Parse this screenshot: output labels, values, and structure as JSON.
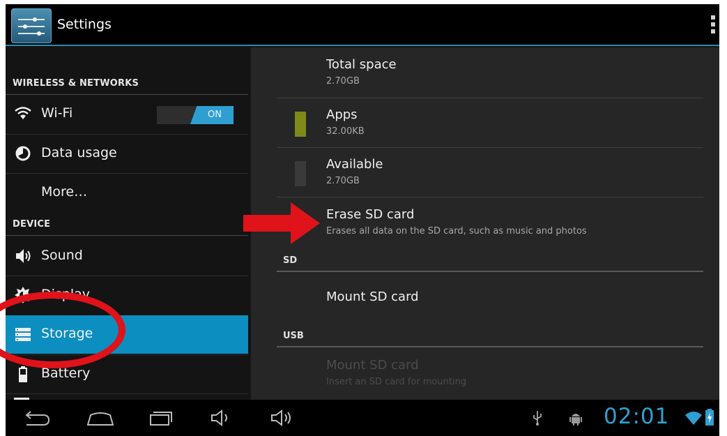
{
  "app": {
    "title": "Settings",
    "icon": "settings-sliders-icon",
    "overflow_icon": "overflow-menu-icon",
    "accent_color": "#2f9fd2",
    "selected_color": "#0c8ec0"
  },
  "sidebar": {
    "sections": [
      {
        "header": "WIRELESS & NETWORKS"
      },
      {
        "header": "DEVICE"
      }
    ],
    "items": [
      {
        "label": "Wi-Fi",
        "icon": "wifi-icon",
        "toggle": "ON"
      },
      {
        "label": "Data usage",
        "icon": "data-usage-icon"
      },
      {
        "label": "More…",
        "icon": ""
      },
      {
        "label": "Sound",
        "icon": "speaker-icon"
      },
      {
        "label": "Display",
        "icon": "brightness-icon"
      },
      {
        "label": "Storage",
        "icon": "storage-icon",
        "selected": true
      },
      {
        "label": "Battery",
        "icon": "battery-icon"
      }
    ]
  },
  "storage": {
    "total": {
      "title": "Total space",
      "value": "2.70GB"
    },
    "apps": {
      "title": "Apps",
      "value": "32.00KB",
      "color": "#7f8a1d"
    },
    "available": {
      "title": "Available",
      "value": "2.70GB",
      "color": "#3a3a3a"
    },
    "erase": {
      "title": "Erase SD card",
      "summary": "Erases all data on the SD card, such as music and photos"
    },
    "sd_header": "SD",
    "mount_sd": {
      "title": "Mount SD card"
    },
    "usb_header": "USB",
    "mount_usb": {
      "title": "Mount SD card",
      "summary": "Insert an SD card for mounting",
      "enabled": false
    }
  },
  "navbar": {
    "buttons": [
      "back-icon",
      "home-icon",
      "recent-apps-icon",
      "volume-down-icon",
      "volume-up-icon"
    ],
    "status_icons": [
      "usb-icon",
      "android-debug-icon",
      "wifi-signal-icon",
      "battery-charging-icon"
    ],
    "clock": "02:01"
  },
  "annotations": {
    "arrow_color": "#e0121a",
    "circle_color": "#e0121a"
  }
}
